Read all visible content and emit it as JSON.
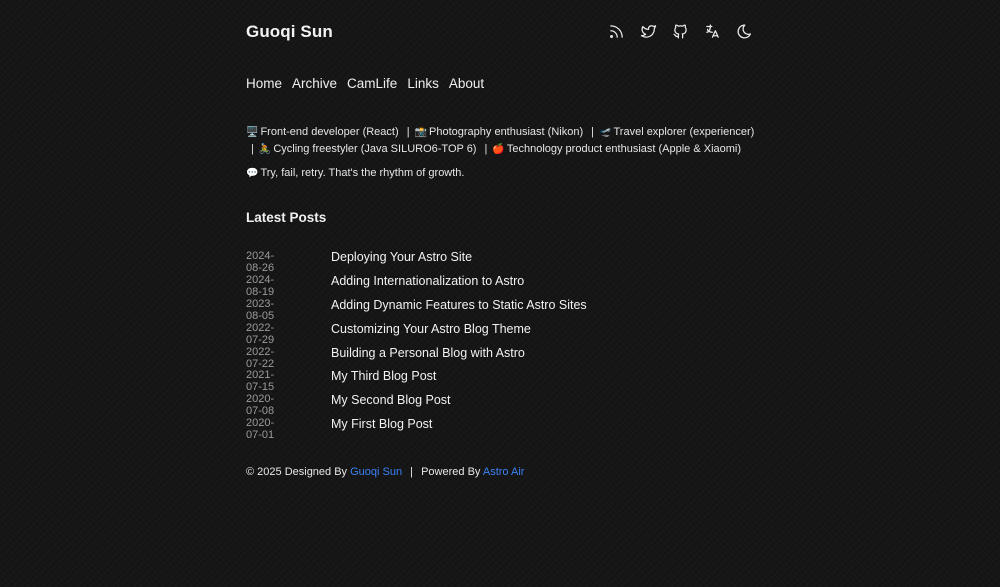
{
  "header": {
    "title": "Guoqi Sun",
    "icons": [
      "rss-icon",
      "twitter-icon",
      "github-icon",
      "translate-icon",
      "moon-icon"
    ]
  },
  "nav": {
    "items": [
      "Home",
      "Archive",
      "CamLife",
      "Links",
      "About"
    ]
  },
  "intro": {
    "items": [
      {
        "emoji": "🖥️",
        "text": "Front-end developer (React)"
      },
      {
        "emoji": "📸",
        "text": "Photography enthusiast (Nikon)"
      },
      {
        "emoji": "🛫",
        "text": "Travel explorer (experiencer)"
      },
      {
        "emoji": "🚴",
        "text": "Cycling freestyler (Java SILURO6-TOP 6)"
      },
      {
        "emoji": "🍎",
        "text": "Technology product enthusiast (Apple & Xiaomi)"
      }
    ],
    "separator": "|",
    "motto_emoji": "💬",
    "motto": "Try, fail, retry. That's the rhythm of growth."
  },
  "latest": {
    "title": "Latest Posts",
    "posts": [
      {
        "date": "2024-08-26",
        "title": "Deploying Your Astro Site"
      },
      {
        "date": "2024-08-19",
        "title": "Adding Internationalization to Astro"
      },
      {
        "date": "2023-08-05",
        "title": "Adding Dynamic Features to Static Astro Sites"
      },
      {
        "date": "2022-07-29",
        "title": "Customizing Your Astro Blog Theme"
      },
      {
        "date": "2022-07-22",
        "title": "Building a Personal Blog with Astro"
      },
      {
        "date": "2021-07-15",
        "title": "My Third Blog Post"
      },
      {
        "date": "2020-07-08",
        "title": "My Second Blog Post"
      },
      {
        "date": "2020-07-01",
        "title": "My First Blog Post"
      }
    ]
  },
  "footer": {
    "copyright": "© 2025 Designed By",
    "author": "Guoqi Sun",
    "separator": "|",
    "powered": "Powered By",
    "theme": "Astro Air"
  },
  "colors": {
    "background": "#161616",
    "link": "#3b82f6",
    "muted": "#9b9b9b"
  }
}
